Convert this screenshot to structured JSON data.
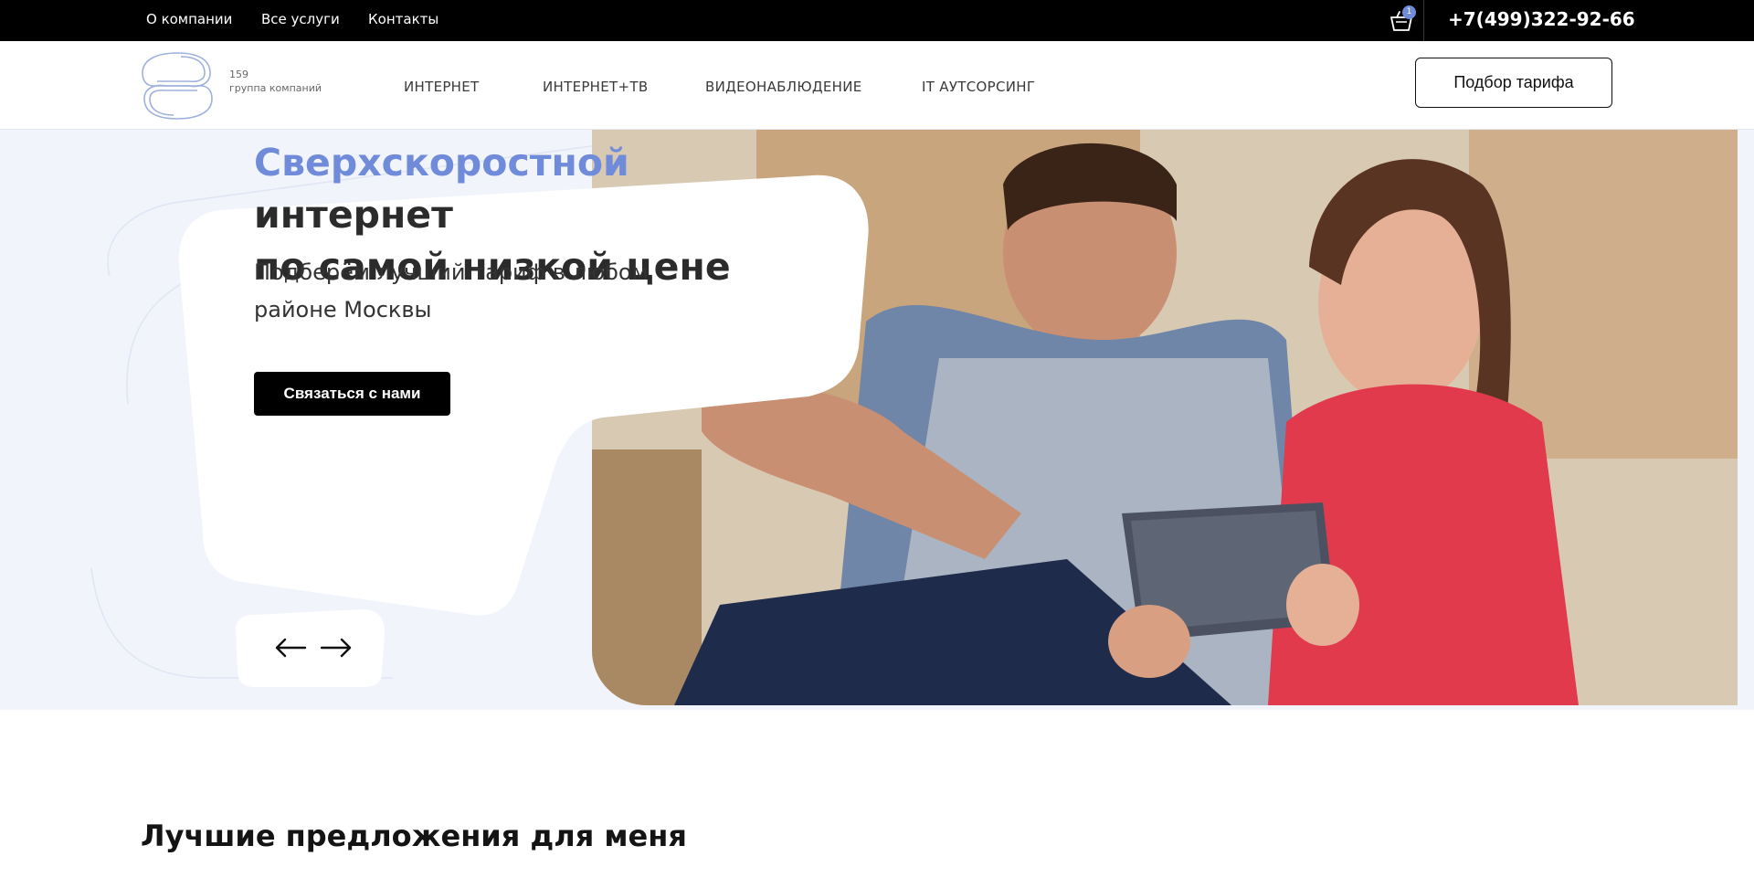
{
  "topbar": {
    "links": [
      "О компании",
      "Все услуги",
      "Контакты"
    ],
    "cart_count": "1",
    "phone": "+7(499)322-92-66"
  },
  "header": {
    "logo_number": "159",
    "logo_subtitle": "группа компаний",
    "nav": [
      "ИНТЕРНЕТ",
      "ИНТЕРНЕТ+ТВ",
      "ВИДЕОНАБЛЮДЕНИЕ",
      "IT АУТСОРСИНГ"
    ],
    "tariff_button": "Подбор тарифа"
  },
  "hero": {
    "title_accent": "Сверхскоростной",
    "title_rest_1": " интернет",
    "title_line_2": "по самой низкой цене",
    "subtitle_line_1": "Подберём лучший тариф в любом",
    "subtitle_line_2": "районе Москвы",
    "cta": "Связаться с нами",
    "prev_icon": "arrow-left-icon",
    "next_icon": "arrow-right-icon"
  },
  "section": {
    "title": "Лучшие предложения для меня"
  },
  "colors": {
    "accent": "#6f8bd9",
    "topbar": "#000000",
    "hero_bg": "#f1f4fb"
  }
}
